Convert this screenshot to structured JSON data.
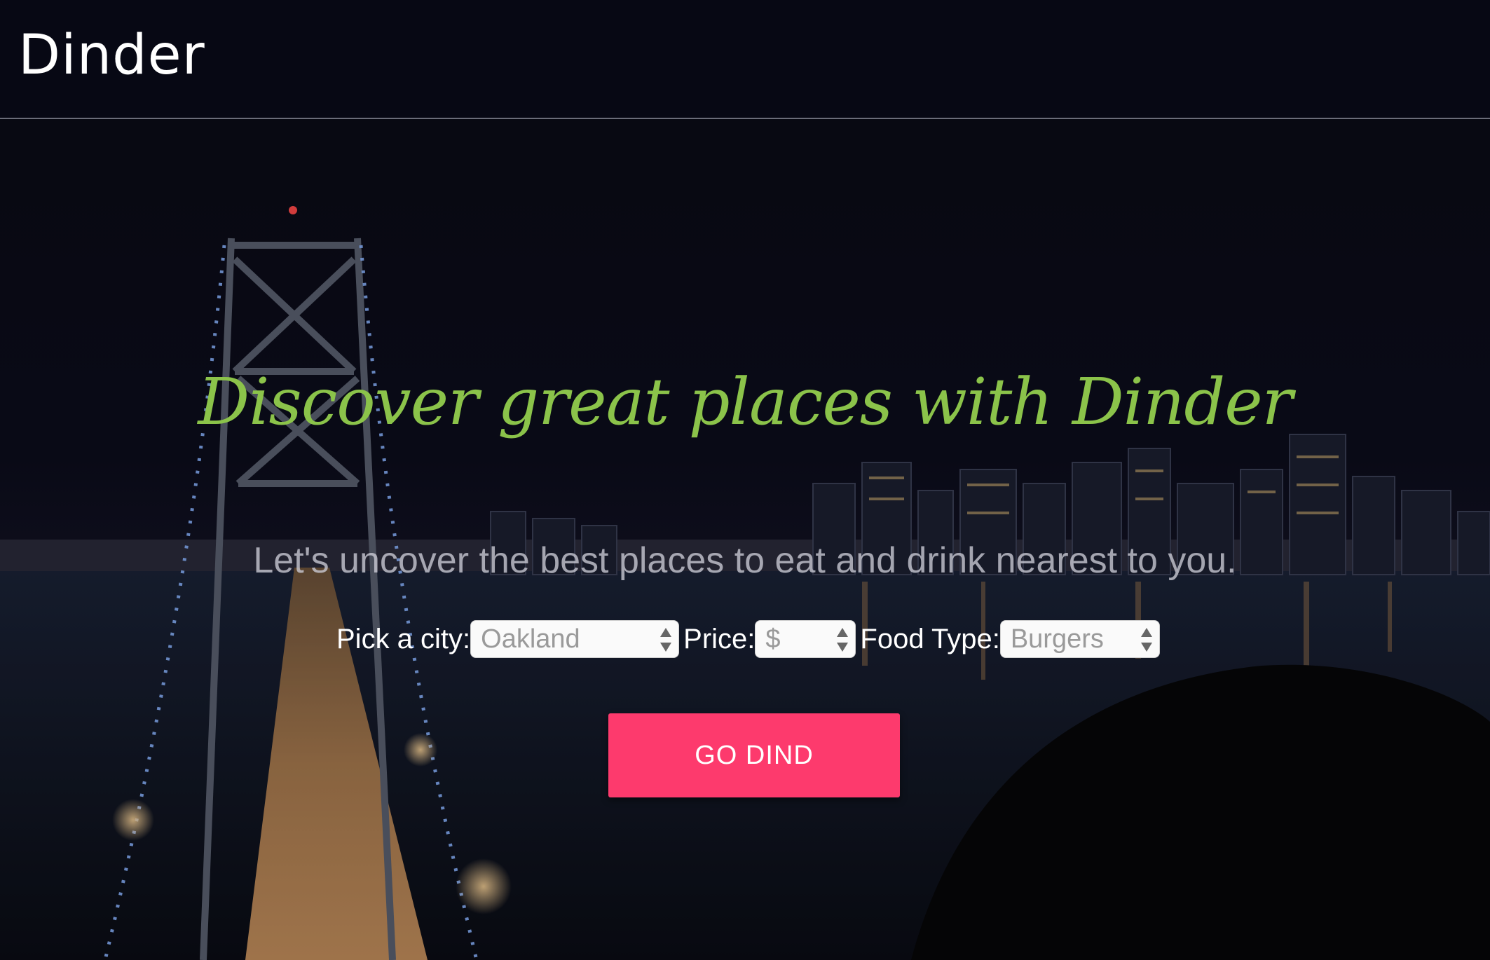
{
  "header": {
    "brand": "Dinder"
  },
  "hero": {
    "headline": "Discover great places with Dinder",
    "tagline": "Let's uncover the best places to eat and drink nearest to you.",
    "background_image": "night-city-bridge-skyline"
  },
  "filters": {
    "city": {
      "label": "Pick a city:",
      "value": "Oakland"
    },
    "price": {
      "label": "Price:",
      "value": "$"
    },
    "food_type": {
      "label": "Food Type:",
      "value": "Burgers"
    }
  },
  "actions": {
    "go_label": "GO DIND"
  },
  "colors": {
    "headline": "#8bc34a",
    "button": "#fd3a6d",
    "navbar": "#070814"
  }
}
